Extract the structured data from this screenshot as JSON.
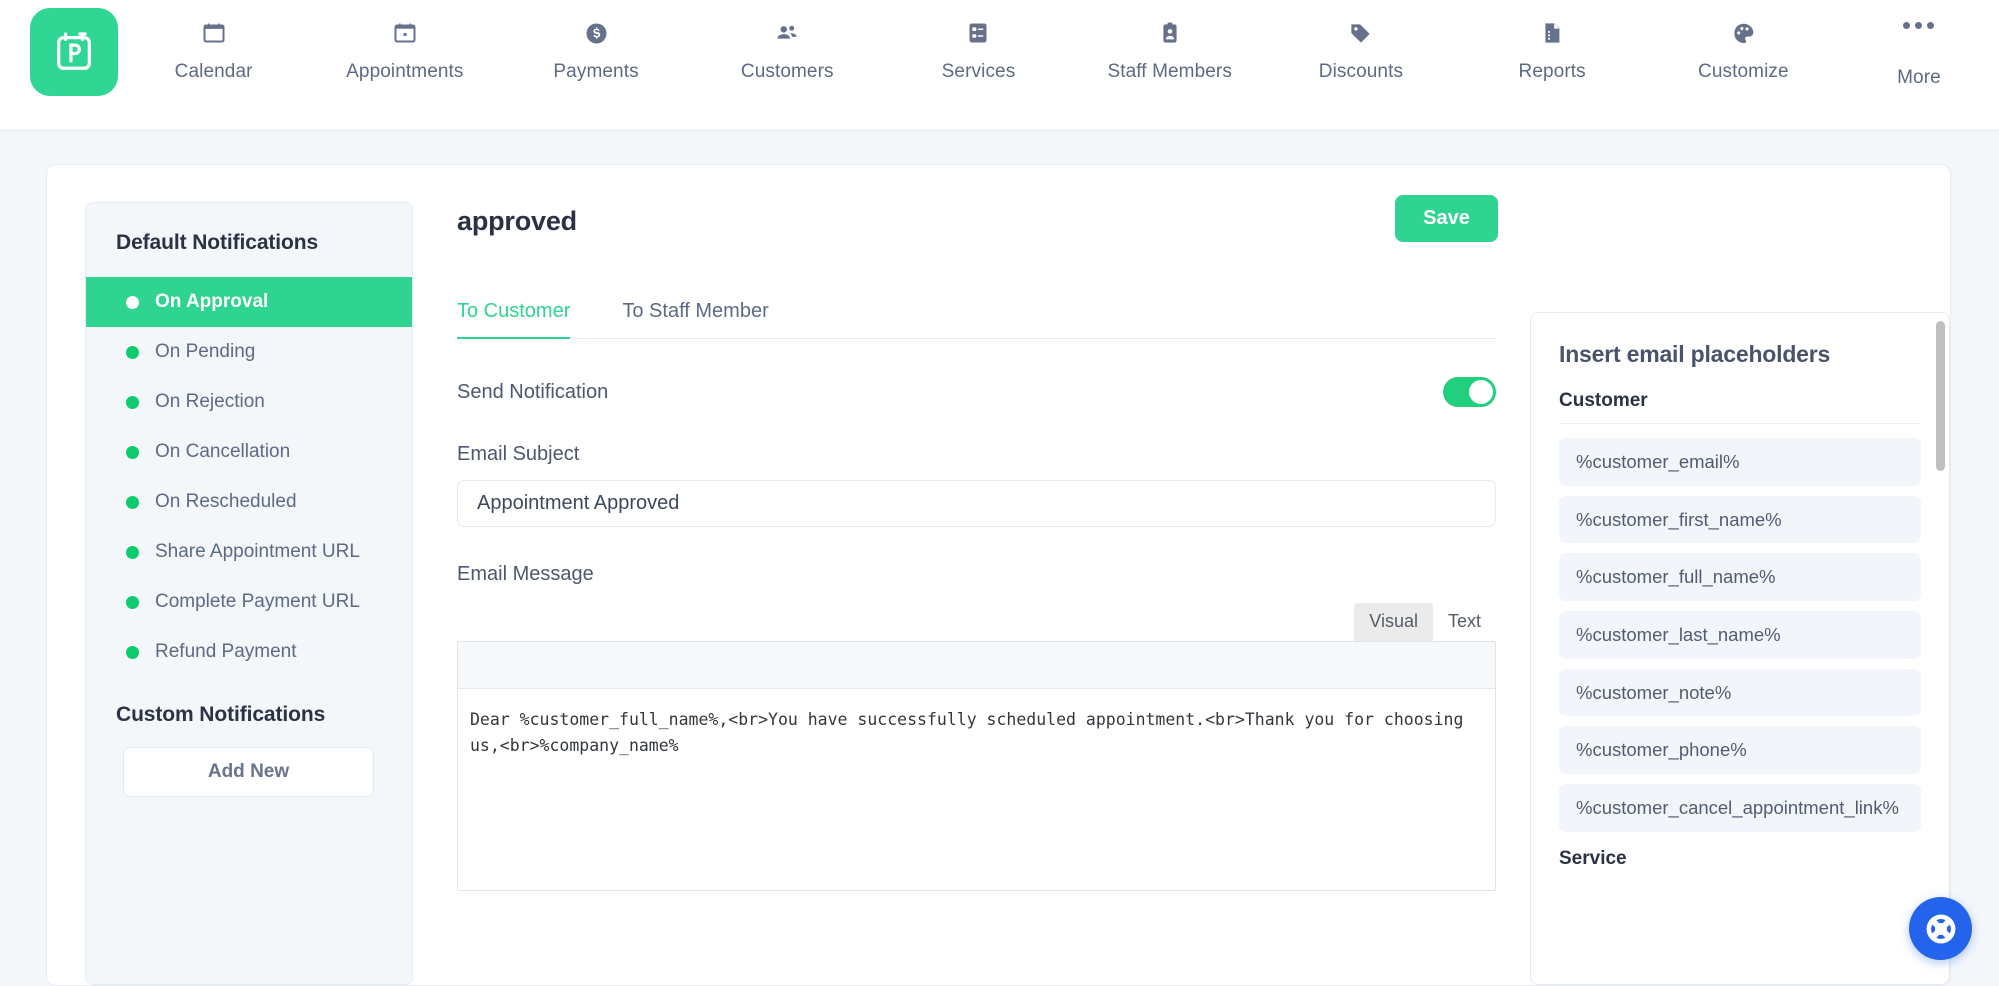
{
  "topnav": {
    "brand_icon": "clipboard-plus-logo",
    "brand_color": "#2fd694",
    "items": [
      {
        "label": "Calendar",
        "icon": "calendar-icon"
      },
      {
        "label": "Appointments",
        "icon": "appointments-calendar-icon"
      },
      {
        "label": "Payments",
        "icon": "dollar-circle-icon"
      },
      {
        "label": "Customers",
        "icon": "people-icon"
      },
      {
        "label": "Services",
        "icon": "services-list-icon"
      },
      {
        "label": "Staff Members",
        "icon": "id-badge-icon"
      },
      {
        "label": "Discounts",
        "icon": "tag-icon"
      },
      {
        "label": "Reports",
        "icon": "report-document-icon"
      },
      {
        "label": "Customize",
        "icon": "palette-icon"
      },
      {
        "label": "More",
        "icon": "ellipsis-icon"
      }
    ]
  },
  "sidebar": {
    "default_heading": "Default Notifications",
    "items": [
      {
        "label": "On Approval",
        "active": true
      },
      {
        "label": "On Pending",
        "active": false
      },
      {
        "label": "On Rejection",
        "active": false
      },
      {
        "label": "On Cancellation",
        "active": false
      },
      {
        "label": "On Rescheduled",
        "active": false
      },
      {
        "label": "Share Appointment URL",
        "active": false
      },
      {
        "label": "Complete Payment URL",
        "active": false
      },
      {
        "label": "Refund Payment",
        "active": false
      }
    ],
    "custom_heading": "Custom Notifications",
    "add_new_label": "Add New"
  },
  "main": {
    "title": "approved",
    "save_label": "Save",
    "tabs": [
      {
        "label": "To Customer",
        "active": true
      },
      {
        "label": "To Staff Member",
        "active": false
      }
    ],
    "send_notification_label": "Send Notification",
    "send_notification_on": true,
    "email_subject_label": "Email Subject",
    "email_subject_value": "Appointment Approved",
    "email_subject_placeholder": "Email Subject",
    "email_message_label": "Email Message",
    "editor_tabs": [
      {
        "label": "Visual",
        "selected": true
      },
      {
        "label": "Text",
        "selected": false
      }
    ],
    "email_message_value": "Dear %customer_full_name%,<br>You have successfully scheduled appointment.<br>Thank you for choosing us,<br>%company_name%"
  },
  "placeholders": {
    "title": "Insert email placeholders",
    "groups": [
      {
        "name": "Customer",
        "items": [
          "%customer_email%",
          "%customer_first_name%",
          "%customer_full_name%",
          "%customer_last_name%",
          "%customer_note%",
          "%customer_phone%",
          "%customer_cancel_appointment_link%"
        ]
      },
      {
        "name": "Service",
        "items": []
      }
    ]
  },
  "support": {
    "icon": "lifebuoy-icon",
    "color": "#2463eb"
  },
  "colors": {
    "accent_green": "#2ed48f",
    "bullet_green": "#0ecb6e",
    "nav_text": "#5d6a85",
    "heading": "#2b3245",
    "panel_bg": "#f3f7fa"
  }
}
